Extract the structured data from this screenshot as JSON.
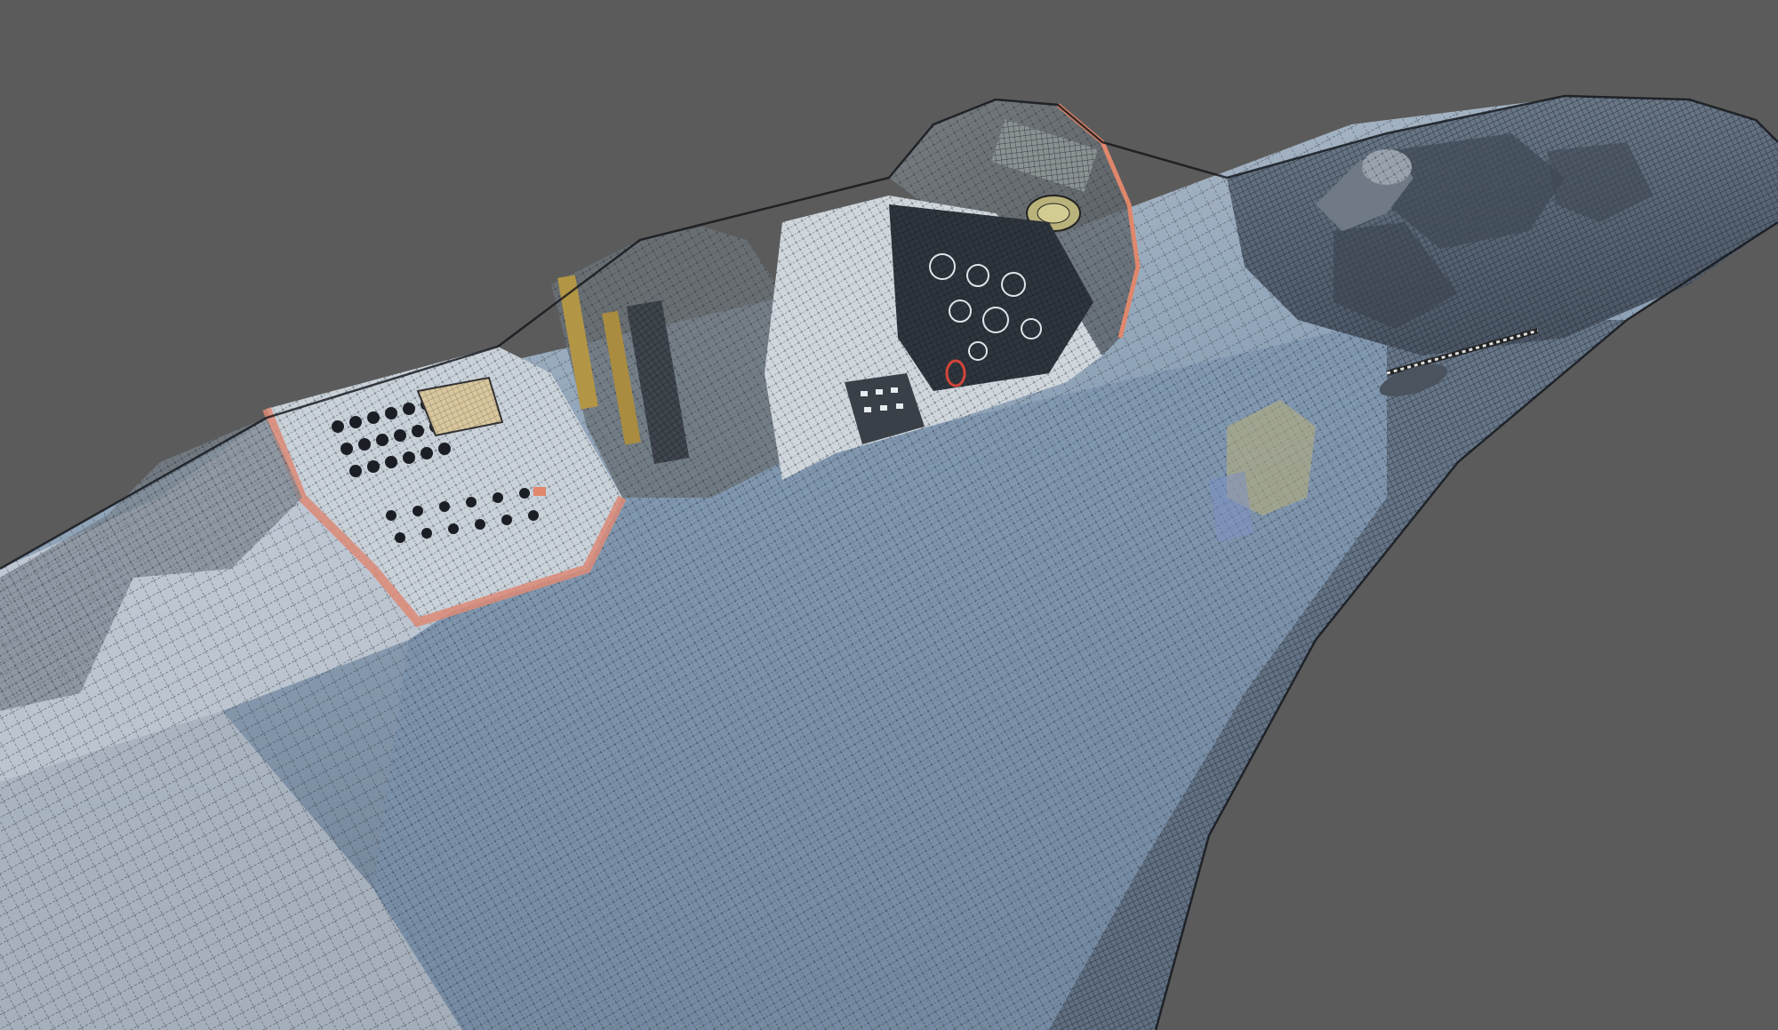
{
  "scene": {
    "subject": "wireframe-3d-model-of-fighter-jet-forward-fuselage-and-cockpit",
    "colors": {
      "background": "#5b5b5b",
      "fuselage_light": "#c4ccd6",
      "fuselage_blue": "#7f95ad",
      "fuselage_dark": "#556273",
      "wire": "#1e232b",
      "canopy_glass": "#6c7276",
      "canopy_frame_accent": "#e0876c",
      "cockpit_panel": "#d2d8de",
      "cockpit_dark": "#2b3038",
      "console_orange": "#dd8a76",
      "brass_detail": "#b39645"
    },
    "icons": [
      "viewport-render"
    ]
  }
}
